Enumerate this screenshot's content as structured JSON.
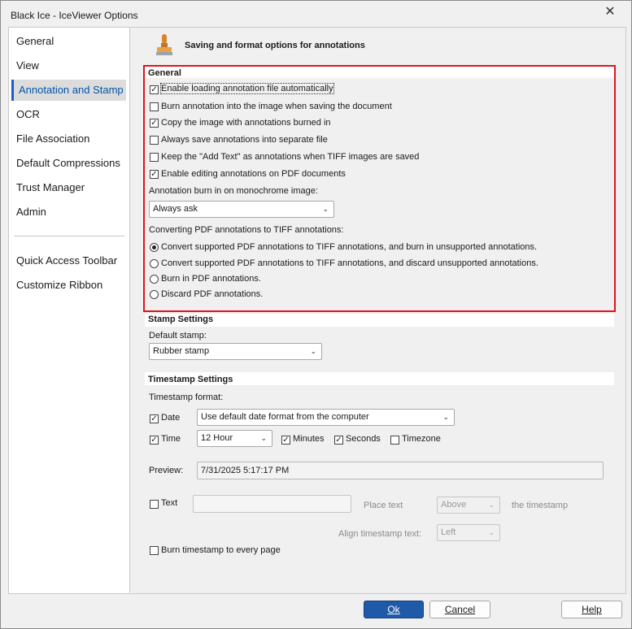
{
  "window": {
    "title": "Black Ice - IceViewer Options",
    "close_glyph": "✕"
  },
  "sidebar": {
    "items": [
      {
        "label": "General"
      },
      {
        "label": "View"
      },
      {
        "label": "Annotation and Stamp"
      },
      {
        "label": "OCR"
      },
      {
        "label": "File Association"
      },
      {
        "label": "Default Compressions"
      },
      {
        "label": "Trust Manager"
      },
      {
        "label": "Admin"
      },
      {
        "label": "Quick Access Toolbar"
      },
      {
        "label": "Customize Ribbon"
      }
    ],
    "active_index": 2
  },
  "header": {
    "title": "Saving and format options for annotations",
    "icon": "rubber-stamp-icon"
  },
  "general": {
    "title": "General",
    "options": [
      {
        "label": "Enable loading annotation file automatically",
        "checked": true
      },
      {
        "label": "Burn annotation into the image when saving the document",
        "checked": false
      },
      {
        "label": "Copy the image with annotations burned in",
        "checked": true
      },
      {
        "label": "Always save annotations into separate file",
        "checked": false
      },
      {
        "label": "Keep the \"Add Text\" as annotations when TIFF images are saved",
        "checked": false
      },
      {
        "label": "Enable editing annotations on PDF documents",
        "checked": true
      }
    ],
    "burn_label": "Annotation burn in on monochrome image:",
    "burn_value": "Always ask",
    "convert_label": "Converting PDF annotations to TIFF annotations:",
    "convert_options": [
      {
        "label": "Convert supported PDF annotations to TIFF annotations, and burn in unsupported annotations.",
        "selected": true
      },
      {
        "label": "Convert supported PDF annotations to TIFF annotations, and discard unsupported annotations.",
        "selected": false
      },
      {
        "label": "Burn in PDF annotations.",
        "selected": false
      },
      {
        "label": "Discard PDF annotations.",
        "selected": false
      }
    ]
  },
  "stamp": {
    "title": "Stamp Settings",
    "default_label": "Default stamp:",
    "default_value": "Rubber stamp"
  },
  "timestamp": {
    "title": "Timestamp Settings",
    "format_label": "Timestamp format:",
    "date_label": "Date",
    "date_checked": true,
    "date_value": "Use default date format from the computer",
    "time_label": "Time",
    "time_checked": true,
    "time_value": "12 Hour",
    "minutes_label": "Minutes",
    "minutes_checked": true,
    "seconds_label": "Seconds",
    "seconds_checked": true,
    "timezone_label": "Timezone",
    "timezone_checked": false,
    "preview_label": "Preview:",
    "preview_value": "7/31/2025 5:17:17 PM",
    "text_label": "Text",
    "text_checked": false,
    "text_value": "",
    "place_label": "Place text",
    "place_value": "Above",
    "place_suffix": "the timestamp",
    "align_label": "Align timestamp text:",
    "align_value": "Left",
    "burn_every_label": "Burn timestamp to every page",
    "burn_every_checked": false
  },
  "footer": {
    "ok": "Ok",
    "cancel": "Cancel",
    "help": "Help"
  }
}
